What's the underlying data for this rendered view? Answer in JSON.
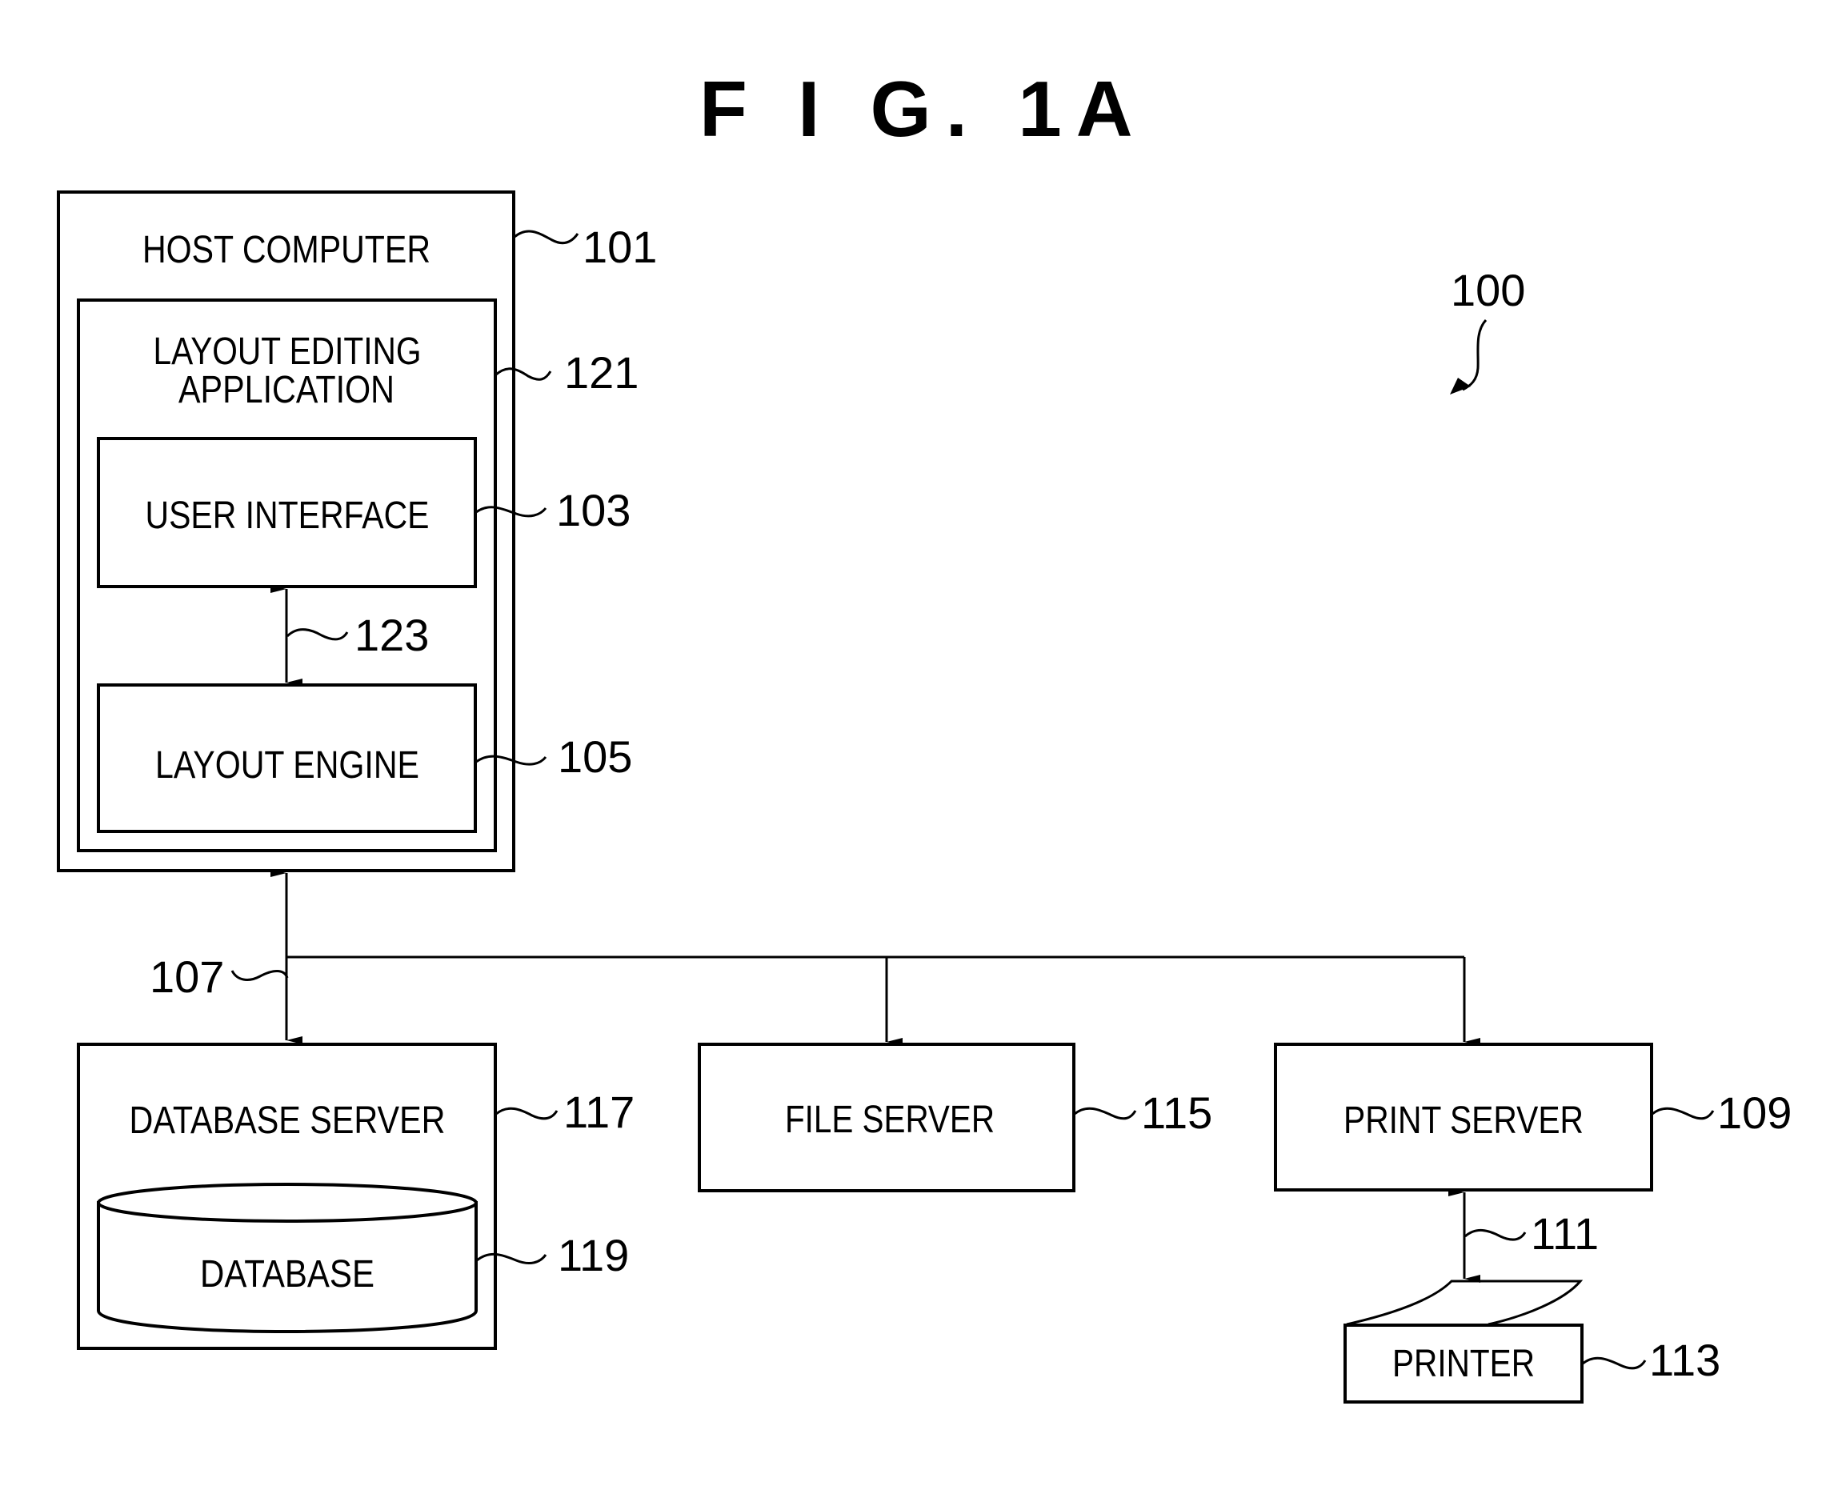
{
  "figure": {
    "title": "F I G. 1A",
    "system_ref": "100"
  },
  "colors": {
    "ink": "#000000",
    "paper": "#ffffff"
  },
  "components": {
    "host_computer": {
      "label": "HOST COMPUTER",
      "ref": "101"
    },
    "layout_editing_application": {
      "label_line1": "LAYOUT EDITING",
      "label_line2": "APPLICATION",
      "ref": "121"
    },
    "user_interface": {
      "label": "USER INTERFACE",
      "ref": "103"
    },
    "layout_engine": {
      "label": "LAYOUT ENGINE",
      "ref": "105"
    },
    "database_server": {
      "label": "DATABASE SERVER",
      "ref": "117"
    },
    "database": {
      "label": "DATABASE",
      "ref": "119"
    },
    "file_server": {
      "label": "FILE SERVER",
      "ref": "115"
    },
    "print_server": {
      "label": "PRINT SERVER",
      "ref": "109"
    },
    "printer": {
      "label": "PRINTER",
      "ref": "113"
    }
  },
  "connections": {
    "ui_engine_link": {
      "ref": "123"
    },
    "network": {
      "ref": "107"
    },
    "printer_link": {
      "ref": "111"
    }
  }
}
